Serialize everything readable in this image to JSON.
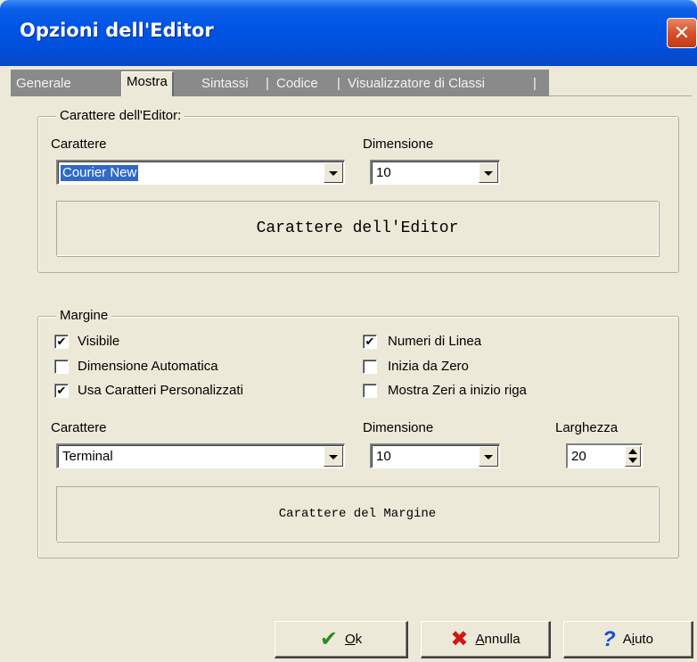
{
  "window": {
    "title": "Opzioni dell'Editor",
    "close_glyph": "✕"
  },
  "tabs": [
    {
      "label": "Generale"
    },
    {
      "label": "Mostra"
    },
    {
      "label": "Sintassi"
    },
    {
      "label": "Codice"
    },
    {
      "label": "Visualizzatore di Classi"
    }
  ],
  "tab_separator": "|",
  "editor_font": {
    "legend": "Carattere dell'Editor:",
    "font_label": "Carattere",
    "font_value": "Courier New",
    "size_label": "Dimensione",
    "size_value": "10",
    "preview_text": "Carattere dell'Editor"
  },
  "margin": {
    "legend": "Margine",
    "checks_left": [
      {
        "label": "Visibile",
        "checked": true,
        "mark": "✔"
      },
      {
        "label": "Dimensione Automatica",
        "checked": false,
        "mark": ""
      },
      {
        "label": "Usa Caratteri Personalizzati",
        "checked": true,
        "mark": "✔"
      }
    ],
    "checks_right": [
      {
        "label": "Numeri di Linea",
        "checked": true,
        "mark": "✔"
      },
      {
        "label": "Inizia da Zero",
        "checked": false,
        "mark": ""
      },
      {
        "label": "Mostra Zeri a inizio riga",
        "checked": false,
        "mark": ""
      }
    ],
    "font_label": "Carattere",
    "font_value": "Terminal",
    "size_label": "Dimensione",
    "size_value": "10",
    "width_label": "Larghezza",
    "width_value": "20",
    "preview_text": "Carattere del Margine"
  },
  "buttons": {
    "ok": {
      "mnemonic": "O",
      "rest": "k",
      "icon": "check-icon",
      "icon_glyph": "✔",
      "icon_color": "#2b8a1e"
    },
    "cancel": {
      "mnemonic": "A",
      "rest": "nnulla",
      "icon": "x-icon",
      "icon_glyph": "✖",
      "icon_color": "#d01818"
    },
    "help": {
      "mnemonic": "i",
      "pre": "A",
      "rest": "uto",
      "icon": "question-icon",
      "icon_glyph": "?",
      "icon_color": "#1a4fd0"
    }
  },
  "colors": {
    "titlebar": "#0055e5",
    "face": "#ece9d8",
    "selection": "#316ac5",
    "close": "#d5512b"
  }
}
